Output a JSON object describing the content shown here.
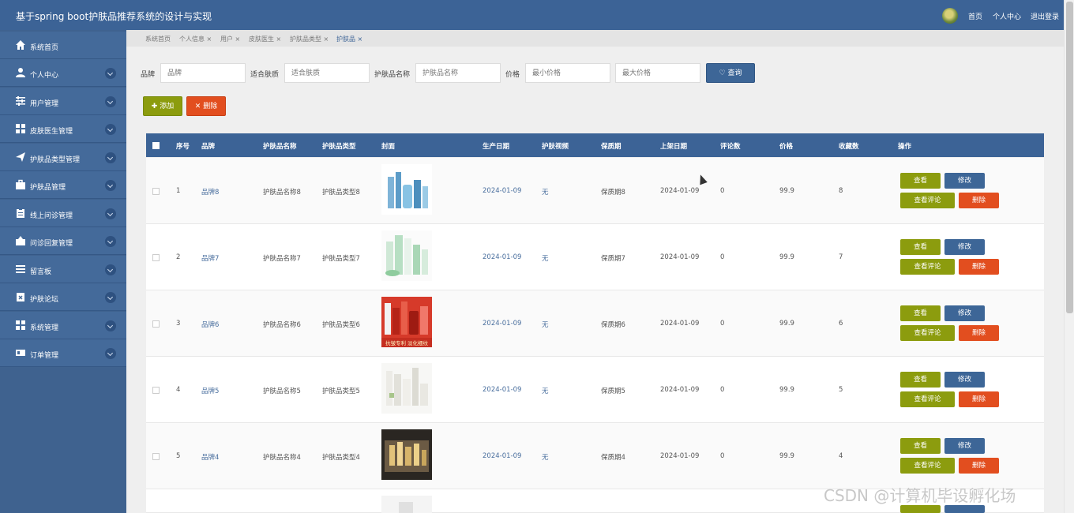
{
  "header": {
    "title": "基于spring boot护肤品推荐系统的设计与实现",
    "links": [
      "首页",
      "个人中心",
      "退出登录"
    ]
  },
  "sidebar": {
    "items": [
      {
        "label": "系统首页",
        "icon": "home-icon"
      },
      {
        "label": "个人中心",
        "icon": "user-icon"
      },
      {
        "label": "用户管理",
        "icon": "sliders-icon"
      },
      {
        "label": "皮肤医生管理",
        "icon": "grid-icon"
      },
      {
        "label": "护肤品类型管理",
        "icon": "send-icon"
      },
      {
        "label": "护肤品管理",
        "icon": "briefcase-icon"
      },
      {
        "label": "线上问诊管理",
        "icon": "clipboard-icon"
      },
      {
        "label": "问诊回复管理",
        "icon": "inbox-icon"
      },
      {
        "label": "留言板",
        "icon": "list-icon"
      },
      {
        "label": "护肤论坛",
        "icon": "clipboard-x-icon"
      },
      {
        "label": "系统管理",
        "icon": "grid-icon"
      },
      {
        "label": "订单管理",
        "icon": "card-icon"
      }
    ]
  },
  "tabs": [
    {
      "label": "系统首页"
    },
    {
      "label": "个人信息 ×"
    },
    {
      "label": "用户 ×"
    },
    {
      "label": "皮肤医生 ×"
    },
    {
      "label": "护肤品类型 ×"
    },
    {
      "label": "护肤品 ×"
    }
  ],
  "search": {
    "brand_label": "品牌",
    "brand_placeholder": "品牌",
    "skin_label": "适合肤质",
    "skin_placeholder": "适合肤质",
    "name_label": "护肤品名称",
    "name_placeholder": "护肤品名称",
    "price_label": "价格",
    "min_placeholder": "最小价格",
    "max_placeholder": "最大价格",
    "search_button": "♡ 查询"
  },
  "actions": {
    "add": "✚ 添加",
    "delete": "✕ 删除"
  },
  "table": {
    "headers": [
      "序号",
      "品牌",
      "护肤品名称",
      "护肤品类型",
      "封面",
      "生产日期",
      "护肤视频",
      "保质期",
      "上架日期",
      "评论数",
      "价格",
      "收藏数",
      "操作"
    ],
    "row_buttons": {
      "view": "查看",
      "edit": "修改",
      "comments": "查看评论",
      "delete": "删除"
    },
    "rows": [
      {
        "no": "1",
        "brand": "品牌8",
        "name": "护肤品名称8",
        "type": "护肤品类型8",
        "produced": "2024-01-09",
        "video": "无",
        "shelf": "保质期8",
        "listed": "2024-01-09",
        "comments": "0",
        "price": "99.9",
        "favs": "8",
        "cover": "blue"
      },
      {
        "no": "2",
        "brand": "品牌7",
        "name": "护肤品名称7",
        "type": "护肤品类型7",
        "produced": "2024-01-09",
        "video": "无",
        "shelf": "保质期7",
        "listed": "2024-01-09",
        "comments": "0",
        "price": "99.9",
        "favs": "7",
        "cover": "green"
      },
      {
        "no": "3",
        "brand": "品牌6",
        "name": "护肤品名称6",
        "type": "护肤品类型6",
        "produced": "2024-01-09",
        "video": "无",
        "shelf": "保质期6",
        "listed": "2024-01-09",
        "comments": "0",
        "price": "99.9",
        "favs": "6",
        "cover": "red",
        "cover_caption": "抗皱专利 淡化细纹"
      },
      {
        "no": "4",
        "brand": "品牌5",
        "name": "护肤品名称5",
        "type": "护肤品类型5",
        "produced": "2024-01-09",
        "video": "无",
        "shelf": "保质期5",
        "listed": "2024-01-09",
        "comments": "0",
        "price": "99.9",
        "favs": "5",
        "cover": "white"
      },
      {
        "no": "5",
        "brand": "品牌4",
        "name": "护肤品名称4",
        "type": "护肤品类型4",
        "produced": "2024-01-09",
        "video": "无",
        "shelf": "保质期4",
        "listed": "2024-01-09",
        "comments": "0",
        "price": "99.9",
        "favs": "4",
        "cover": "gold"
      }
    ]
  },
  "watermark": "CSDN @计算机毕设孵化场"
}
